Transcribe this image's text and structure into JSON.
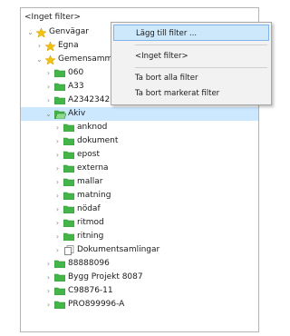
{
  "filter_label": "<Inget filter>",
  "tree": {
    "root": "Genvägar",
    "egna": "Egna",
    "gemensamma": "Gemensamma",
    "items_before": [
      "060",
      "A33",
      "A2342342"
    ],
    "selected": "Akiv",
    "children": [
      "anknod",
      "dokument",
      "epost",
      "externa",
      "mallar",
      "matning",
      "nödaf",
      "ritmod",
      "ritning"
    ],
    "collection": "Dokumentsamlingar",
    "items_after": [
      "88888096",
      "Bygg Projekt 8087",
      "C98876-11",
      "PRO899996-A"
    ]
  },
  "menu": {
    "add_filter": "Lägg till filter ...",
    "no_filter": "<Inget filter>",
    "remove_all": "Ta bort alla filter",
    "remove_selected": "Ta bort markerat filter"
  },
  "colors": {
    "folder_green": "#44b649",
    "star_yellow": "#f4c20d",
    "selection": "#cce8ff",
    "menu_hover": "#cde8fb"
  }
}
